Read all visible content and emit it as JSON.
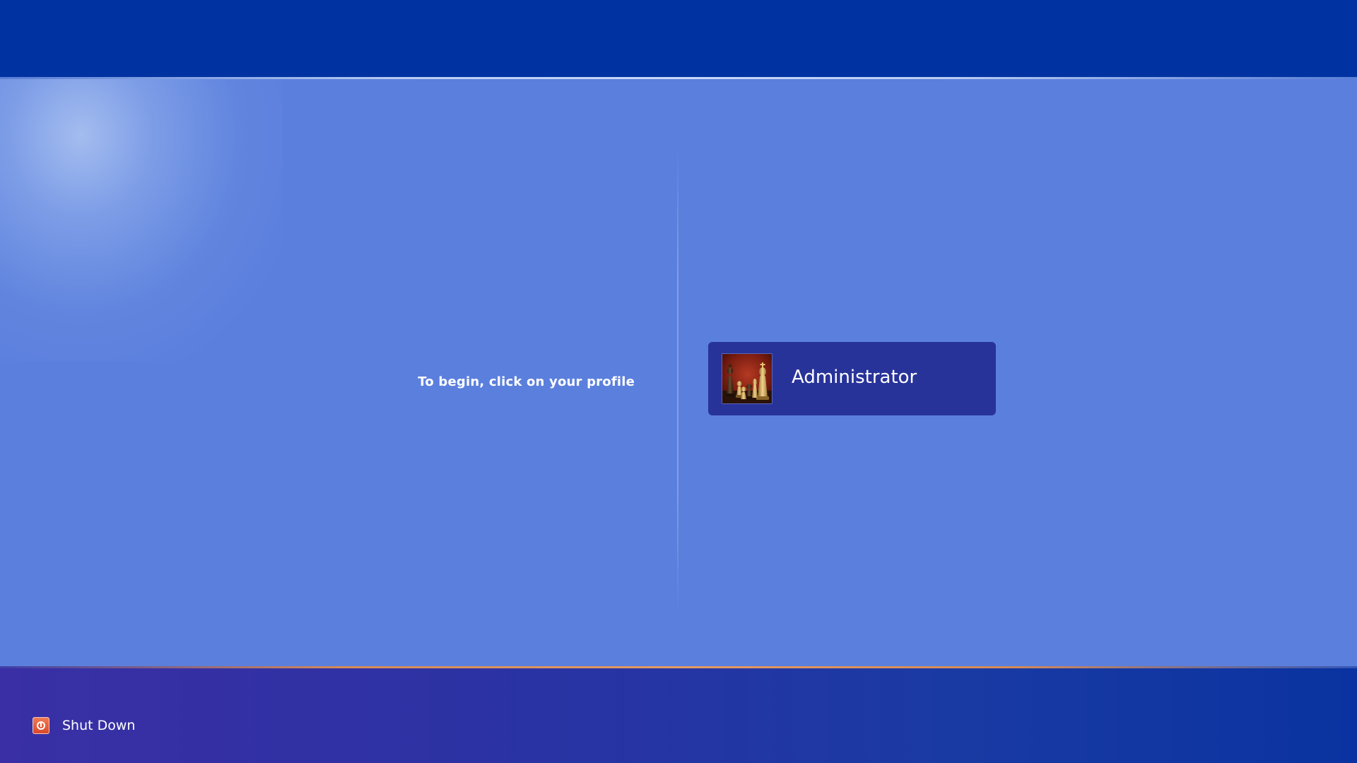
{
  "login": {
    "instruction": "To begin, click on your profile",
    "profiles": [
      {
        "name": "Administrator",
        "avatar": "chess-pieces-avatar"
      }
    ]
  },
  "footer": {
    "shutdown_label": "Shut Down",
    "shutdown_icon": "power-icon"
  },
  "colors": {
    "top_bar": "#0033a1",
    "main_background": "#5b7fdd",
    "profile_tile": "#28339a",
    "bottom_accent": "#e59a62",
    "shutdown_icon": "#e05a38"
  }
}
